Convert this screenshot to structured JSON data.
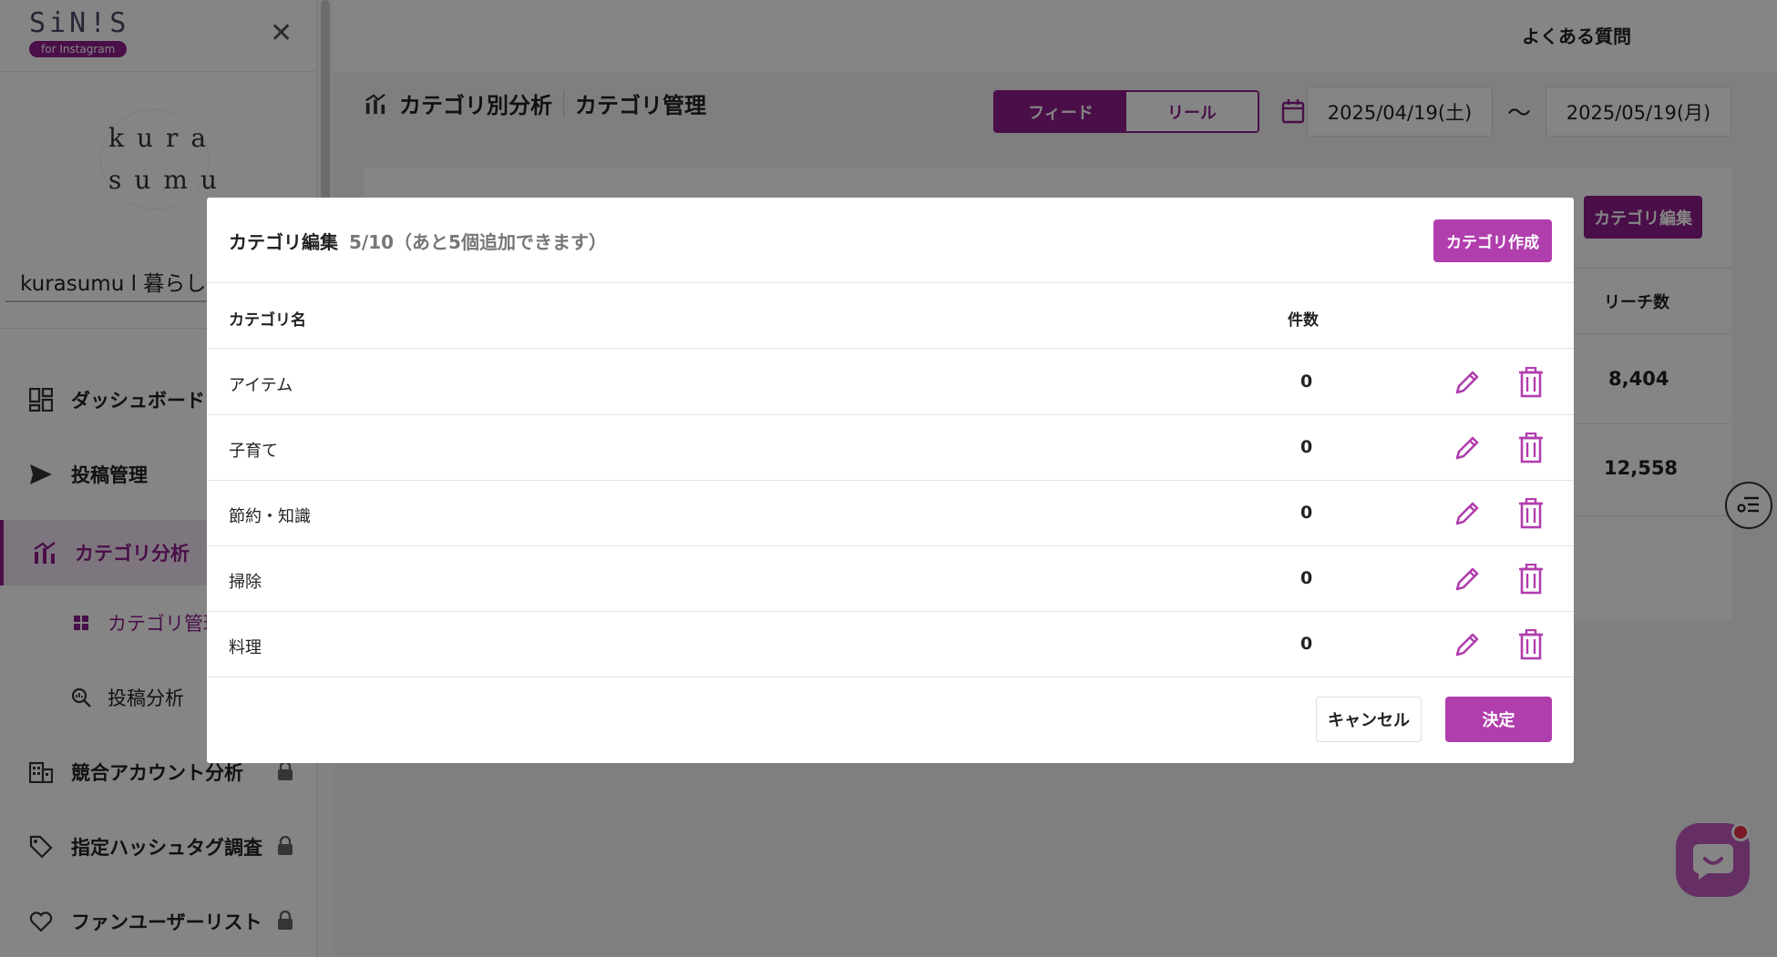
{
  "brand": {
    "logo_text": "SiN!S",
    "logo_badge": "for Instagram"
  },
  "account": {
    "logo_line1": "kura",
    "logo_line2": "sumu",
    "name": "kurasumu l 暮らしい"
  },
  "sidebar": {
    "items": [
      {
        "label": "ダッシュボード",
        "icon": "dashboard-icon"
      },
      {
        "label": "投稿管理",
        "icon": "send-icon"
      },
      {
        "label": "カテゴリ分析",
        "icon": "bar-chart-icon"
      },
      {
        "label": "カテゴリ管理",
        "icon": "grid-icon"
      },
      {
        "label": "投稿分析",
        "icon": "search-chart-icon"
      },
      {
        "label": "競合アカウント分析",
        "icon": "building-icon"
      },
      {
        "label": "指定ハッシュタグ調査",
        "icon": "tag-icon"
      },
      {
        "label": "ファンユーザーリスト",
        "icon": "heart-icon"
      }
    ]
  },
  "header": {
    "faq": "よくある質問",
    "title": "カテゴリ別分析",
    "subtitle": "カテゴリ管理",
    "tab_feed": "フィード",
    "tab_reel": "リール",
    "date_from": "2025/04/19(土)",
    "date_sep": "〜",
    "date_to": "2025/05/19(月)"
  },
  "card": {
    "edit_button": "カテゴリ編集",
    "reach_header": "リーチ数",
    "reach_values": [
      "8,404",
      "12,558"
    ]
  },
  "modal": {
    "title": "カテゴリ編集",
    "count_text": "5/10（あと5個追加できます）",
    "create_button": "カテゴリ作成",
    "col_name": "カテゴリ名",
    "col_count": "件数",
    "rows": [
      {
        "name": "アイテム",
        "count": "0"
      },
      {
        "name": "子育て",
        "count": "0"
      },
      {
        "name": "節約・知識",
        "count": "0"
      },
      {
        "name": "掃除",
        "count": "0"
      },
      {
        "name": "料理",
        "count": "0"
      }
    ],
    "cancel_button": "キャンセル",
    "confirm_button": "決定"
  },
  "colors": {
    "accent": "#8e1d8a",
    "accent_light": "#b03ead",
    "overlay": "rgba(0,0,0,0.48)"
  }
}
